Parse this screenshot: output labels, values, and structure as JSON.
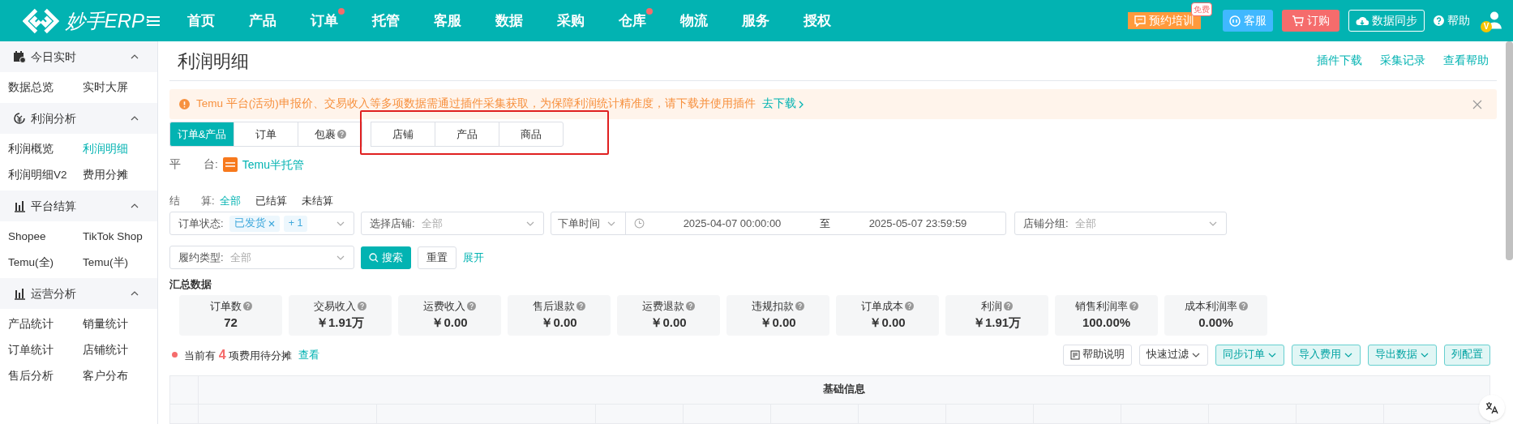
{
  "brand": {
    "name": "妙手ERP"
  },
  "nav": [
    {
      "label": "首页",
      "dot": false
    },
    {
      "label": "产品",
      "dot": false
    },
    {
      "label": "订单",
      "dot": true
    },
    {
      "label": "托管",
      "dot": false
    },
    {
      "label": "客服",
      "dot": false
    },
    {
      "label": "数据",
      "dot": false
    },
    {
      "label": "采购",
      "dot": false
    },
    {
      "label": "仓库",
      "dot": true
    },
    {
      "label": "物流",
      "dot": false
    },
    {
      "label": "服务",
      "dot": false
    },
    {
      "label": "授权",
      "dot": false
    }
  ],
  "header_actions": [
    {
      "kind": "training",
      "label": "预约培训",
      "badge": "免费"
    },
    {
      "kind": "service",
      "label": "客服"
    },
    {
      "kind": "order",
      "label": "订购"
    },
    {
      "kind": "sync",
      "label": "数据同步"
    },
    {
      "kind": "help",
      "label": "帮助"
    }
  ],
  "user": {
    "badge": "V"
  },
  "sidebar": [
    {
      "title": "今日实时",
      "expanded": true,
      "items": [
        {
          "label": "数据总览",
          "selected": false
        },
        {
          "label": "实时大屏",
          "selected": false
        }
      ]
    },
    {
      "title": "利润分析",
      "expanded": true,
      "items": [
        {
          "label": "利润概览",
          "selected": false
        },
        {
          "label": "利润明细",
          "selected": true
        },
        {
          "label": "利润明细V2",
          "selected": false
        },
        {
          "label": "费用分摊",
          "selected": false
        }
      ]
    },
    {
      "title": "平台结算",
      "expanded": true,
      "items": [
        {
          "label": "Shopee",
          "selected": false
        },
        {
          "label": "TikTok Shop",
          "selected": false
        },
        {
          "label": "Temu(全)",
          "selected": false
        },
        {
          "label": "Temu(半)",
          "selected": false
        }
      ]
    },
    {
      "title": "运营分析",
      "expanded": true,
      "items": [
        {
          "label": "产品统计",
          "selected": false
        },
        {
          "label": "销量统计",
          "selected": false
        },
        {
          "label": "订单统计",
          "selected": false
        },
        {
          "label": "店铺统计",
          "selected": false
        },
        {
          "label": "售后分析",
          "selected": false
        },
        {
          "label": "客户分布",
          "selected": false
        }
      ]
    }
  ],
  "page": {
    "title": "利润明细",
    "links": [
      "插件下载",
      "采集记录",
      "查看帮助"
    ]
  },
  "alert": {
    "text": "Temu 平台(活动)申报价、交易收入等多项数据需通过插件采集获取，为保障利润统计精准度，请下载并使用插件",
    "link": "去下载"
  },
  "tabs": [
    {
      "label": "订单&产品",
      "selected": true,
      "help": false
    },
    {
      "label": "订单",
      "selected": false,
      "help": false
    },
    {
      "label": "包裹",
      "selected": false,
      "help": true
    },
    {
      "label": "店铺",
      "selected": false,
      "help": false
    },
    {
      "label": "产品",
      "selected": false,
      "help": false
    },
    {
      "label": "商品",
      "selected": false,
      "help": false
    }
  ],
  "platform": {
    "label": "平　　台:",
    "value": "Temu半托管"
  },
  "settlement": {
    "label": "结　　算:",
    "options": [
      {
        "label": "全部",
        "selected": true
      },
      {
        "label": "已结算",
        "selected": false
      },
      {
        "label": "未结算",
        "selected": false
      }
    ]
  },
  "filters": {
    "order_status": {
      "label": "订单状态:",
      "tags": [
        "已发货",
        "+ 1"
      ]
    },
    "store": {
      "label": "选择店铺:",
      "value": "全部"
    },
    "time_type": "下单时间",
    "date_from": "2025-04-07 00:00:00",
    "date_sep": "至",
    "date_to": "2025-05-07 23:59:59",
    "store_group": {
      "label": "店铺分组:",
      "value": "全部"
    },
    "fulfil_type": {
      "label": "履约类型:",
      "value": "全部"
    },
    "search": "搜索",
    "reset": "重置",
    "expand": "展开"
  },
  "summary": {
    "title": "汇总数据",
    "cards": [
      {
        "label": "订单数",
        "value": "72"
      },
      {
        "label": "交易收入",
        "value": "￥1.91万"
      },
      {
        "label": "运费收入",
        "value": "￥0.00"
      },
      {
        "label": "售后退款",
        "value": "￥0.00"
      },
      {
        "label": "运费退款",
        "value": "￥0.00"
      },
      {
        "label": "违规扣款",
        "value": "￥0.00"
      },
      {
        "label": "订单成本",
        "value": "￥0.00"
      },
      {
        "label": "利润",
        "value": "￥1.91万"
      },
      {
        "label": "销售利润率",
        "value": "100.00%"
      },
      {
        "label": "成本利润率",
        "value": "0.00%"
      }
    ]
  },
  "pending": {
    "prefix": "当前有",
    "count": "4",
    "suffix": "项费用待分摊",
    "link": "查看"
  },
  "toolbar": [
    {
      "kind": "plain",
      "label": "帮助说明",
      "icon": true,
      "caret": false
    },
    {
      "kind": "plain",
      "label": "快速过滤",
      "icon": false,
      "caret": true
    },
    {
      "kind": "teal",
      "label": "同步订单",
      "icon": false,
      "caret": true
    },
    {
      "kind": "teal",
      "label": "导入费用",
      "icon": false,
      "caret": true
    },
    {
      "kind": "teal",
      "label": "导出数据",
      "icon": false,
      "caret": true
    },
    {
      "kind": "teal",
      "label": "列配置",
      "icon": false,
      "caret": false
    }
  ],
  "table": {
    "group_header": "基础信息"
  }
}
